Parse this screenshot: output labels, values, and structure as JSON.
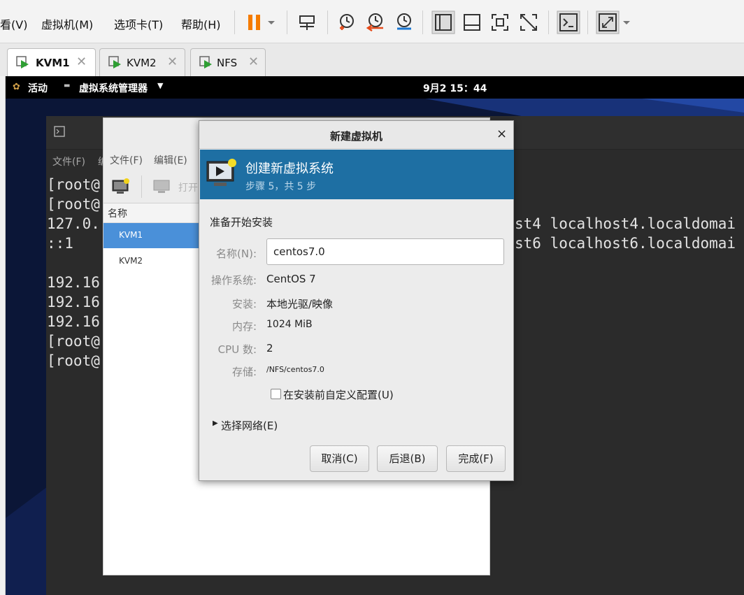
{
  "menu": {
    "view": "看(V)",
    "vm": "虚拟机(M)",
    "tabs": "选项卡(T)",
    "help": "帮助(H)"
  },
  "toolbar": {
    "icons": [
      "pause-icon",
      "dropdown-icon",
      "send-keys-icon",
      "snapshot-icon",
      "revert-snapshot-icon",
      "manage-snapshot-icon",
      "single-view-icon",
      "console-view-icon",
      "fullscreen-icon",
      "unity-icon",
      "terminal-icon",
      "stretch-icon"
    ]
  },
  "tabs": [
    {
      "label": "KVM1",
      "active": true
    },
    {
      "label": "KVM2",
      "active": false
    },
    {
      "label": "NFS",
      "active": false
    }
  ],
  "gnome": {
    "activities": "活动",
    "app_menu": "虚拟系统管理器",
    "clock": "9月2 15：44"
  },
  "terminal": {
    "menu_file": "文件(F)",
    "menu_edit_partial": "编",
    "lines": [
      "[root@",
      "[root@",
      "127.0.",
      "::1",
      "",
      "192.16",
      "192.16",
      "192.16",
      "[root@",
      "[root@"
    ],
    "right_lines": [
      "st4 localhost4.localdomai",
      "st6 localhost6.localdomai"
    ]
  },
  "manager": {
    "menu_file": "文件(F)",
    "menu_edit": "编辑(E)",
    "open_partial": "打开",
    "column_name": "名称",
    "vms": [
      {
        "name": "KVM1",
        "selected": true
      },
      {
        "name": "KVM2",
        "selected": false
      }
    ]
  },
  "dialog": {
    "title": "新建虚拟机",
    "close": "×",
    "banner_title": "创建新虚拟系统",
    "banner_step": "步骤 5，共 5 步",
    "section": "准备开始安装",
    "name_label": "名称(N):",
    "name_value": "centos7.0",
    "os_label": "操作系统:",
    "os_value": "CentOS 7",
    "install_label": "安装:",
    "install_value": "本地光驱/映像",
    "memory_label": "内存:",
    "memory_value": "1024 MiB",
    "cpu_label": "CPU 数:",
    "cpu_value": "2",
    "storage_label": "存储:",
    "storage_value": "/NFS/centos7.0",
    "customize_label": "在安装前自定义配置(U)",
    "customize_checked": false,
    "network_label": "选择网络(E)",
    "cancel": "取消(C)",
    "back": "后退(B)",
    "finish": "完成(F)"
  },
  "colors": {
    "banner": "#1e6fa3",
    "selection": "#4a90d9",
    "pause": "#f57c00",
    "terminal_bg": "#2b2b2b"
  }
}
